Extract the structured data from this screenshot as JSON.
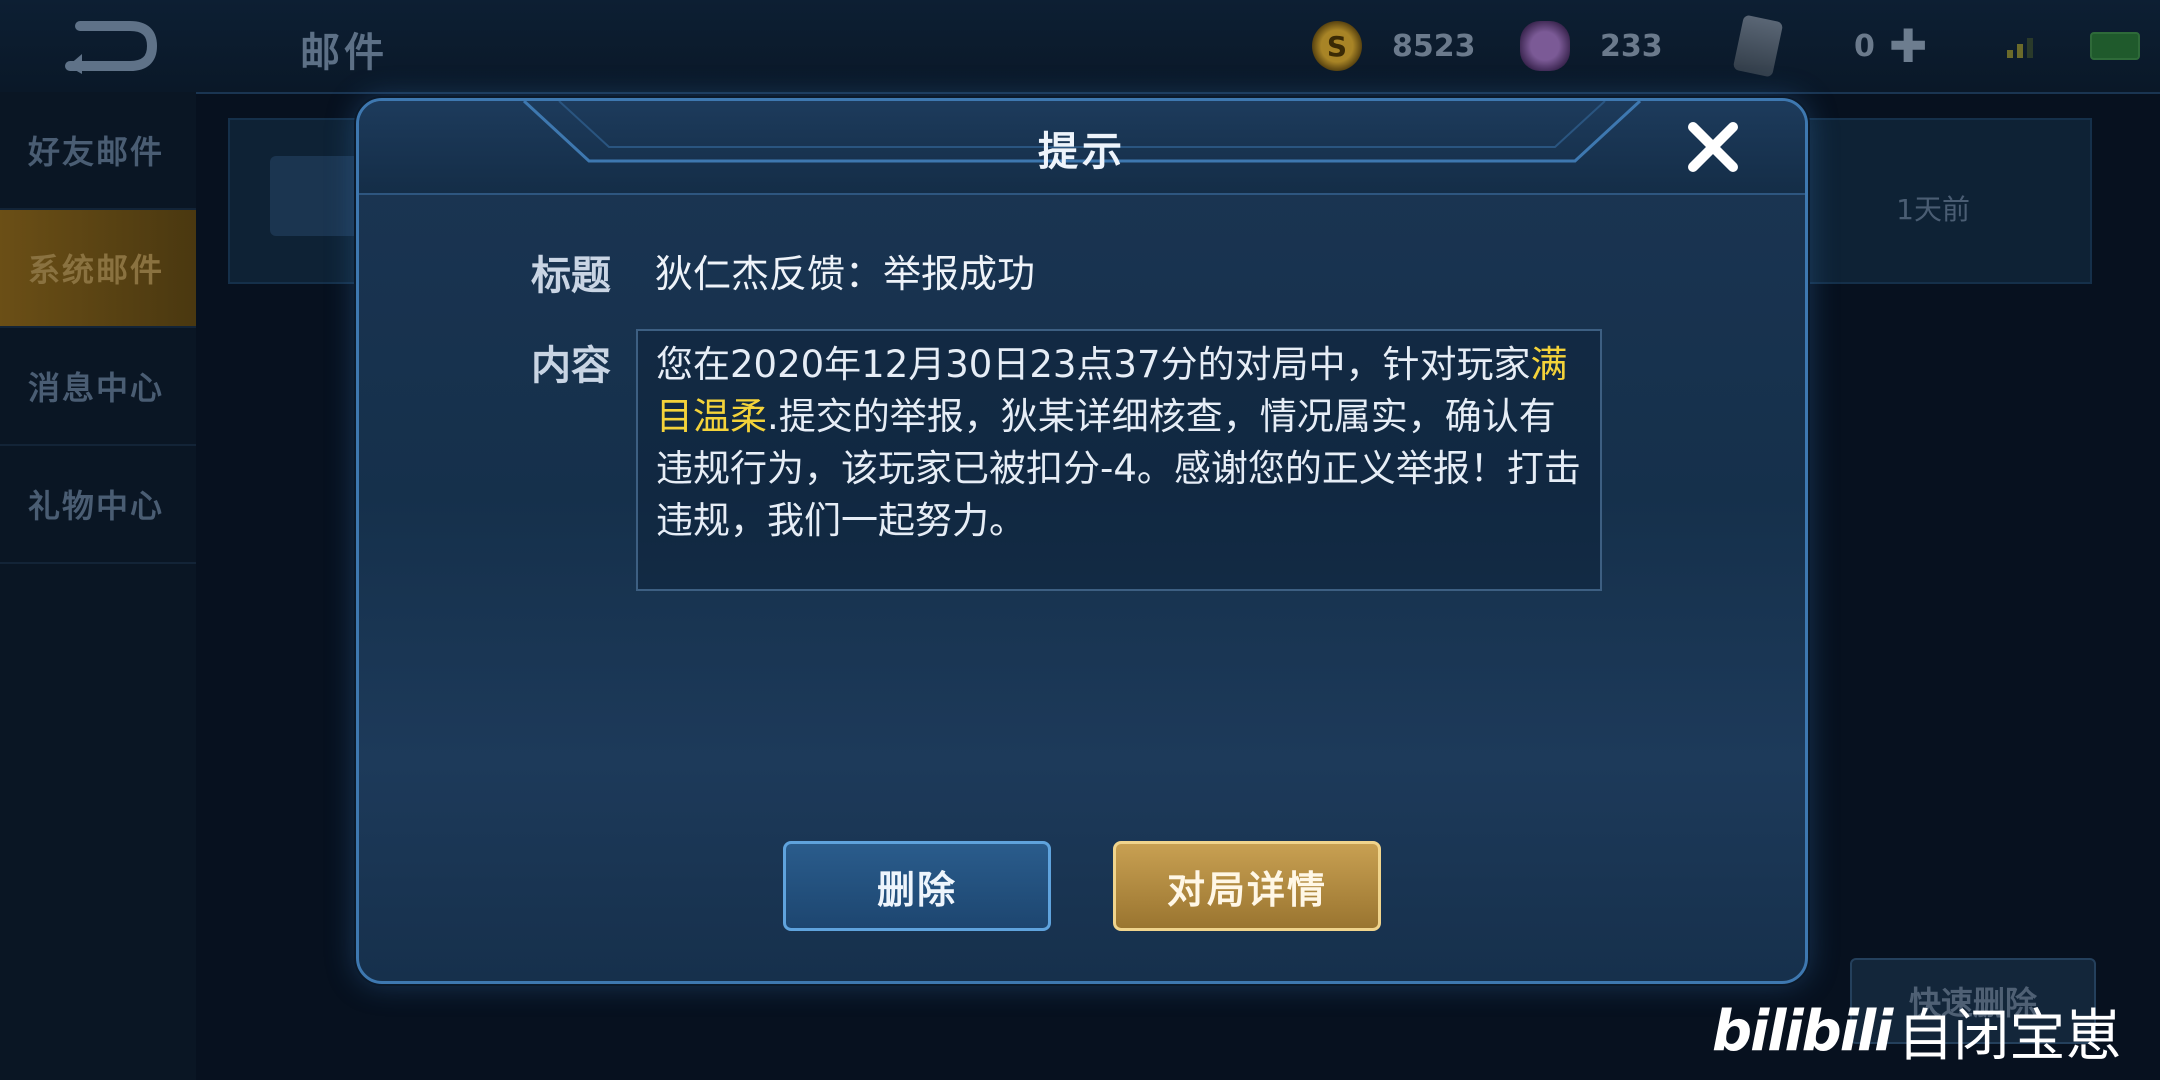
{
  "topbar": {
    "title": "邮件",
    "coins": "8523",
    "gems": "233",
    "cards": "0"
  },
  "sidebar": {
    "items": [
      {
        "label": "好友邮件"
      },
      {
        "label": "系统邮件"
      },
      {
        "label": "消息中心"
      },
      {
        "label": "礼物中心"
      }
    ]
  },
  "mail_list": {
    "time": "1天前",
    "quick_delete_label": "快速删除"
  },
  "dialog": {
    "title": "提示",
    "title_label": "标题",
    "title_value": "狄仁杰反馈：举报成功",
    "content_label": "内容",
    "content_prefix": "您在2020年12月30日23点37分的对局中，针对玩家",
    "content_player": "满目温柔",
    "content_suffix": ".提交的举报，狄某详细核查，情况属实，确认有违规行为，该玩家已被扣分-4。感谢您的正义举报！打击违规，我们一起努力。",
    "delete_label": "删除",
    "detail_label": "对局详情"
  },
  "watermark": {
    "logo": "bilibili",
    "text": "自闭宝崽"
  }
}
